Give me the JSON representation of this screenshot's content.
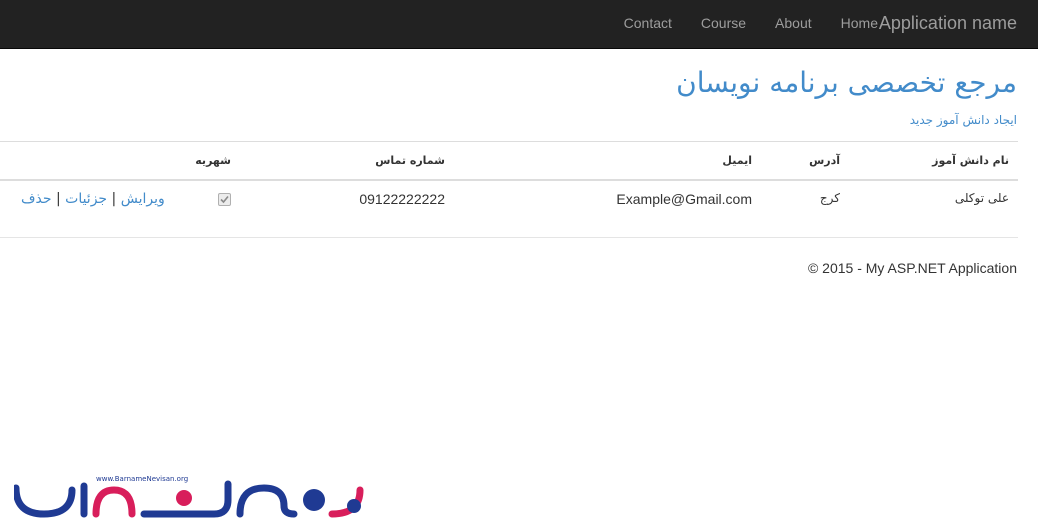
{
  "navbar": {
    "brand": "Application name",
    "links": [
      "Home",
      "About",
      "Course",
      "Contact"
    ]
  },
  "page": {
    "title": "مرجع تخصصی برنامه نویسان",
    "create_link": "ایجاد دانش آموز جدید"
  },
  "table": {
    "headers": {
      "name": "نام دانش آموز",
      "address": "آدرس",
      "email": "ایمیل",
      "phone": "شماره تماس",
      "tuition": "شهریه"
    },
    "rows": [
      {
        "name": "علی توکلی",
        "address": "کرج",
        "email": "Example@Gmail.com",
        "phone": "09122222222",
        "tuition_checked": true,
        "actions": {
          "edit": "ویرایش",
          "details": "جزئیات",
          "delete": "حذف",
          "separator": "|"
        }
      }
    ]
  },
  "footer": {
    "text": "© 2015 - My ASP.NET Application"
  },
  "watermark": {
    "url": "www.BarnameNevisan.org",
    "logo_text": "برنامه نویسان"
  },
  "colors": {
    "navbar_bg": "#222222",
    "nav_text": "#9d9d9d",
    "link": "#428bca",
    "logo_blue": "#1f3a93",
    "logo_red": "#d81e5b"
  }
}
